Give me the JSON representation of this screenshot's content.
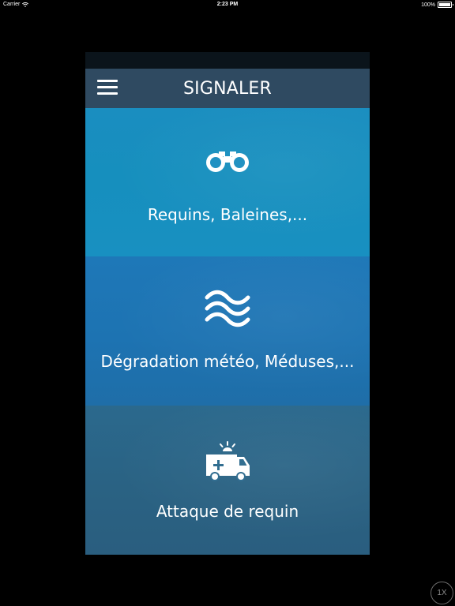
{
  "status_bar": {
    "carrier": "Carrier",
    "time": "2:23 PM",
    "battery": "100%"
  },
  "header": {
    "title": "SIGNALER",
    "menu_icon": "hamburger-menu-icon"
  },
  "panels": [
    {
      "label": "Requins, Baleines,...",
      "icon": "binoculars-icon",
      "color": "#1a8ec0"
    },
    {
      "label": "Dégradation météo, Méduses,...",
      "icon": "waves-icon",
      "color": "#1e78b8"
    },
    {
      "label": "Attaque de requin",
      "icon": "ambulance-icon",
      "color": "#2b698d"
    }
  ],
  "zoom_badge": {
    "label": "1X"
  }
}
